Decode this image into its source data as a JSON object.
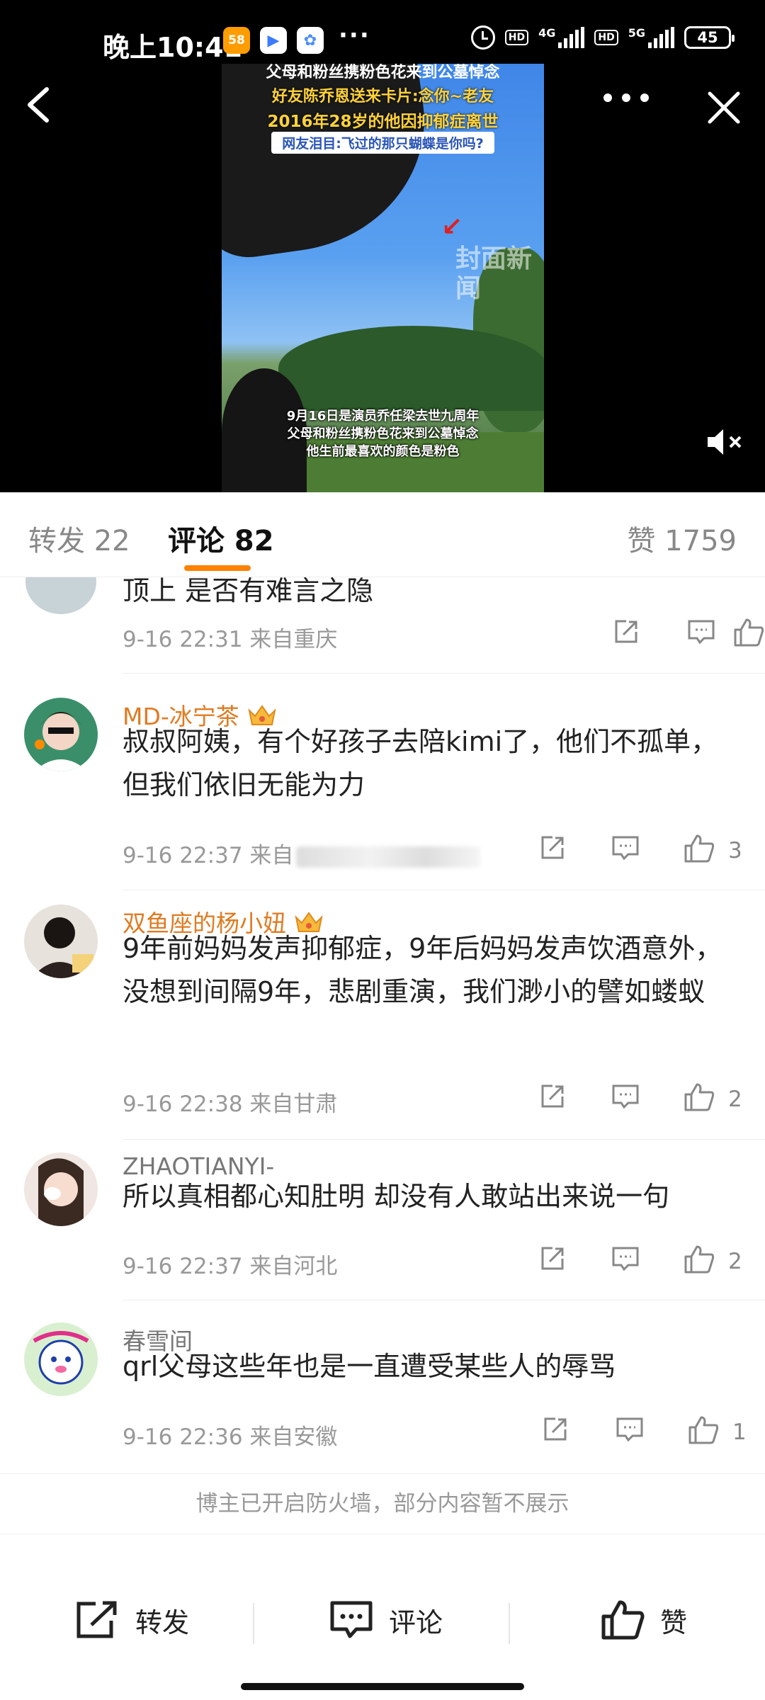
{
  "status_bar": {
    "time": "晚上10:41",
    "badge_58": "58",
    "more": "···",
    "hd1": "HD",
    "net1": "4G",
    "hd2": "HD",
    "net2": "5G",
    "battery": "45"
  },
  "video": {
    "headline_top": "父母和粉丝携粉色花来到公墓悼念",
    "headline_2": "好友陈乔恩送来卡片:念你~老友",
    "headline_3": "2016年28岁的他因抑郁症离世",
    "headline_4": "网友泪目:飞过的那只蝴蝶是你吗?",
    "watermark": "封面新闻",
    "subtitle_1": "9月16日是演员乔任梁去世九周年",
    "subtitle_2": "父母和粉丝携粉色花来到公墓悼念",
    "subtitle_3": "他生前最喜欢的颜色是粉色"
  },
  "tabs": {
    "repost": "转发 22",
    "comment": "评论 82",
    "like": "赞 1759"
  },
  "partial_comment": {
    "text": "顶上 是否有难言之隐",
    "meta": "9-16 22:31  来自重庆"
  },
  "comments": [
    {
      "username": "MD-冰宁茶",
      "text": "叔叔阿姨，有个好孩子去陪kimi了，他们不孤单，但我们依旧无能为力",
      "meta": "9-16 22:37  来自",
      "likes": "3"
    },
    {
      "username": "双鱼座的杨小妞",
      "text": "9年前妈妈发声抑郁症，9年后妈妈发声饮酒意外，没想到间隔9年，悲剧重演，我们渺小的譬如蝼蚁",
      "meta": "9-16 22:38  来自甘肃",
      "likes": "2"
    },
    {
      "username": "ZHAOTIANYI-",
      "text": "所以真相都心知肚明 却没有人敢站出来说一句",
      "meta": "9-16 22:37  来自河北",
      "likes": "2"
    },
    {
      "username": "春雪间",
      "text": "qrl父母这些年也是一直遭受某些人的辱骂",
      "meta": "9-16 22:36  来自安徽",
      "likes": "1"
    }
  ],
  "firewall_notice": "博主已开启防火墙，部分内容暂不展示",
  "bottom_bar": {
    "repost": "转发",
    "comment": "评论",
    "like": "赞"
  },
  "colors": {
    "accent": "#ff8200",
    "vip_name": "#e07b22"
  }
}
